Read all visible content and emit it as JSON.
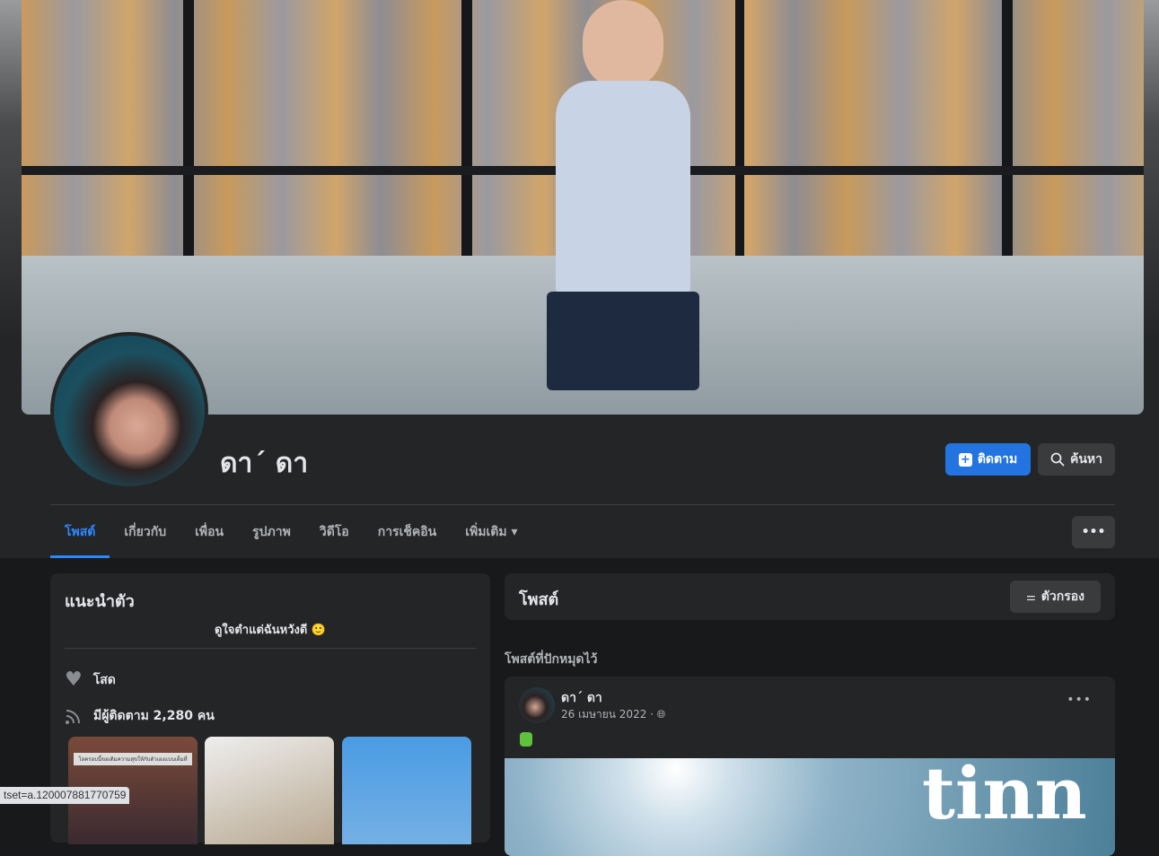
{
  "profile": {
    "name": "ดา´ ดา",
    "follow_label": "ติดตาม",
    "search_label": "ค้นหา"
  },
  "tabs": [
    {
      "label": "โพสต์",
      "active": true
    },
    {
      "label": "เกี่ยวกับ"
    },
    {
      "label": "เพื่อน"
    },
    {
      "label": "รูปภาพ"
    },
    {
      "label": "วิดีโอ"
    },
    {
      "label": "การเช็คอิน"
    },
    {
      "label": "เพิ่มเติม ▾"
    }
  ],
  "more_menu": "•••",
  "intro": {
    "title": "แนะนำตัว",
    "bio": "ดูใจตำแต่ฉันหวังดี 🙂",
    "relationship": "โสด",
    "followers": "มีผู้ติดตาม 2,280 คน",
    "photo_caption": "โลครอบนี้ขอเติมความสุขให้กับตัวเองแบบเต็มที่"
  },
  "posts": {
    "title": "โพสต์",
    "filter_label": "ตัวกรอง",
    "pinned_label": "โพสต์ที่ปักหมุดไว้",
    "items": [
      {
        "author": "ดา´ ดา",
        "date": "26 เมษายน 2022 ·",
        "menu": "•••",
        "image_text": "tinn"
      }
    ]
  },
  "status_bar": "tset=a.120007881770759",
  "colors": {
    "accent": "#2374e1",
    "tab_active": "#2d88ff",
    "card": "#242526",
    "page": "#18191a"
  }
}
